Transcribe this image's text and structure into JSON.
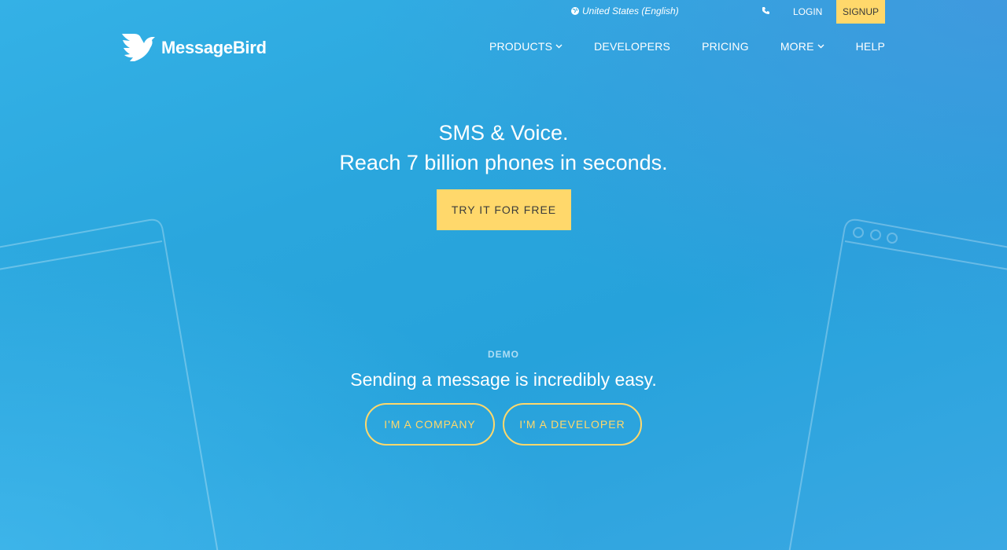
{
  "topbar": {
    "locale": "United States (English)",
    "login": "LOGIN",
    "signup": "SIGNUP"
  },
  "logo": {
    "text": "MessageBird"
  },
  "nav": {
    "items": [
      {
        "label": "PRODUCTS",
        "dropdown": true
      },
      {
        "label": "DEVELOPERS",
        "dropdown": false
      },
      {
        "label": "PRICING",
        "dropdown": false
      },
      {
        "label": "MORE",
        "dropdown": true
      },
      {
        "label": "HELP",
        "dropdown": false
      }
    ]
  },
  "hero": {
    "line1": "SMS & Voice.",
    "line2": "Reach 7 billion phones in seconds.",
    "cta": "TRY IT FOR FREE"
  },
  "demo": {
    "label": "DEMO",
    "title": "Sending a message is incredibly easy.",
    "company_button": "I'M A COMPANY",
    "developer_button": "I'M A DEVELOPER"
  },
  "colors": {
    "accent": "#ffd86b",
    "background": "#2aa6dd"
  },
  "icons": [
    "globe-icon",
    "phone-icon",
    "bird-logo-icon",
    "chevron-down-icon"
  ]
}
